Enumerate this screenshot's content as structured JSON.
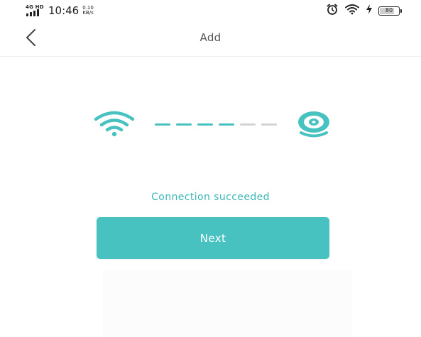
{
  "status_bar": {
    "network_type": "4G HD",
    "time": "10:46",
    "speed_value": "0.10",
    "speed_unit": "KB/s",
    "battery_level": "80",
    "battery_percent": 80
  },
  "header": {
    "back_icon": "chevron-left-icon",
    "title": "Add"
  },
  "illustration": {
    "wifi_icon": "wifi-icon",
    "camera_icon": "camera-icon",
    "dash_total": 6,
    "dash_active": 4
  },
  "status": {
    "message": "Connection succeeded"
  },
  "actions": {
    "next_label": "Next"
  },
  "colors": {
    "accent": "#48C1C1",
    "accent_text": "#3BB6B6",
    "dash_inactive": "#D3D3D3"
  }
}
